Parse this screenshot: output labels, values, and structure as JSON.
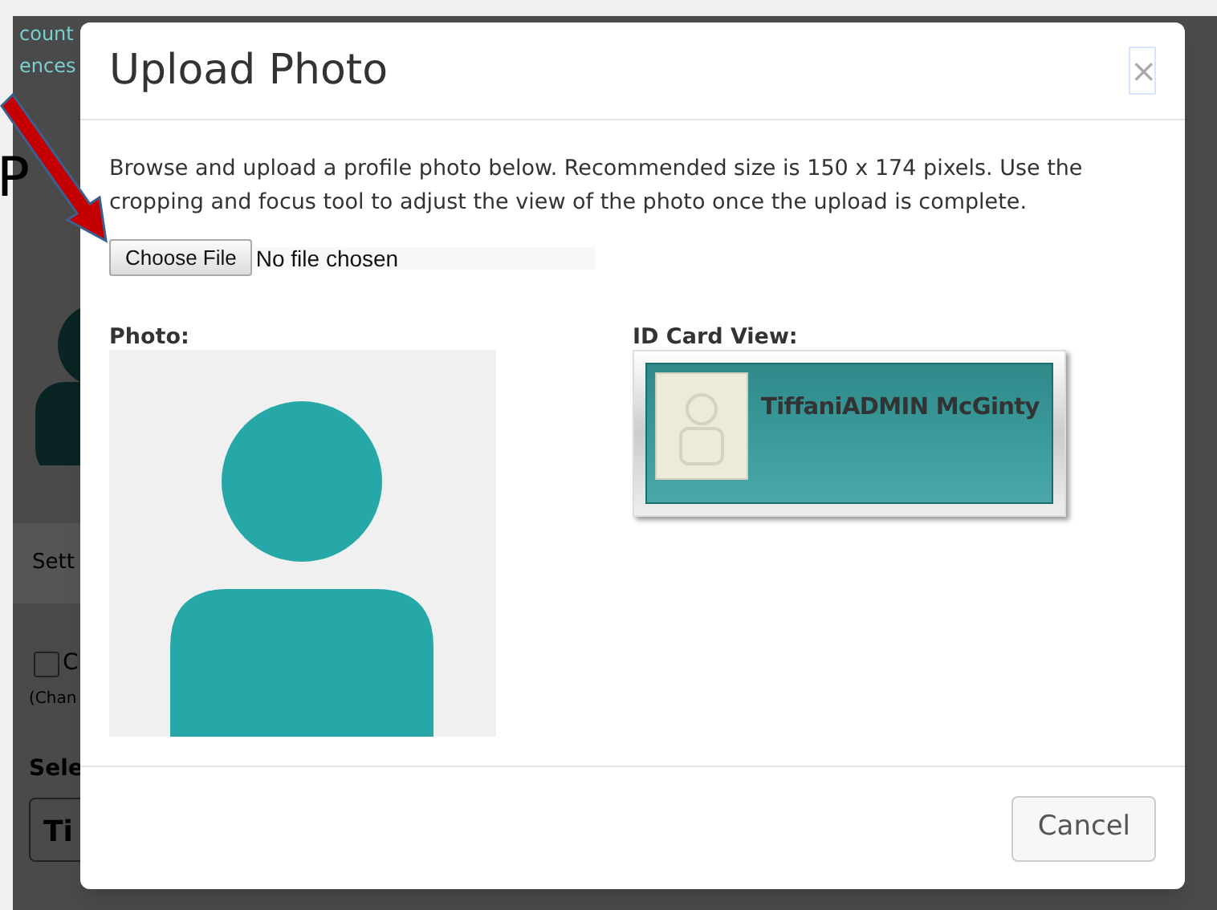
{
  "background": {
    "links": [
      "count",
      "ences"
    ],
    "heading": "P",
    "tab": "Sett",
    "checkbox": {
      "label": "C",
      "checked": false
    },
    "note": "(Chan",
    "select_label": "Sele",
    "select_value": "Ti"
  },
  "modal": {
    "title": "Upload Photo",
    "close": "×",
    "description": "Browse and upload a profile photo below. Recommended size is 150 x 174 pixels. Use the cropping and focus tool to adjust the view of the photo once the upload is complete.",
    "file_input": {
      "button": "Choose File",
      "status": "No file chosen"
    },
    "photo_label": "Photo:",
    "id_card_label": "ID Card View:",
    "id_card": {
      "name": "TiffaniADMIN McGinty"
    },
    "buttons": [
      "Cancel"
    ]
  }
}
